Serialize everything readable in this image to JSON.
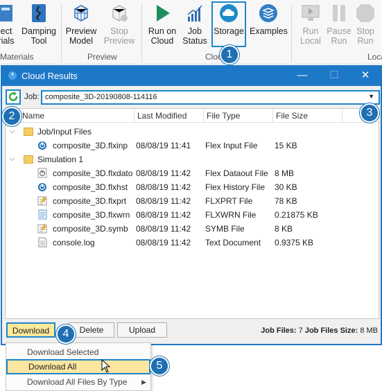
{
  "ribbon": {
    "buttons": [
      {
        "label1": "ect",
        "label2": "rials",
        "icon": "material-icon"
      },
      {
        "label1": "Damping",
        "label2": "Tool",
        "icon": "damping-icon"
      },
      {
        "label1": "Preview",
        "label2": "Model",
        "icon": "preview-cube-icon"
      },
      {
        "label1": "Stop",
        "label2": "Preview",
        "icon": "stop-preview-icon"
      },
      {
        "label1": "Run on",
        "label2": "Cloud",
        "icon": "play-icon"
      },
      {
        "label1": "Job",
        "label2": "Status",
        "icon": "bar-chart-icon"
      },
      {
        "label1": "Storage",
        "label2": "",
        "icon": "cloud-icon"
      },
      {
        "label1": "Examples",
        "label2": "",
        "icon": "examples-icon"
      },
      {
        "label1": "Run",
        "label2": "Local",
        "icon": "run-local-icon"
      },
      {
        "label1": "Pause",
        "label2": "Run",
        "icon": "pause-icon"
      },
      {
        "label1": "Stop",
        "label2": "Run",
        "icon": "stop-icon"
      }
    ],
    "groups": {
      "materials": "Materials",
      "preview": "Preview",
      "cloud": "Clou",
      "local": "Loca"
    }
  },
  "window": {
    "title": "Cloud Results",
    "controls": {
      "minimize": "—",
      "maximize": "☐",
      "close": "✕"
    }
  },
  "job": {
    "label": "Job:",
    "value": "composite_3D-20190808-114116"
  },
  "columns": [
    "Name",
    "Last Modified",
    "File Type",
    "File Size"
  ],
  "tree": [
    {
      "kind": "folder",
      "name": "Job/Input Files"
    },
    {
      "kind": "file",
      "name": "composite_3D.flxinp",
      "modified": "08/08/19 11:41",
      "type": "Flex Input File",
      "size": "15 KB",
      "icon": "power-icon"
    },
    {
      "kind": "folder",
      "name": "Simulation 1"
    },
    {
      "kind": "file",
      "name": "composite_3D.flxdato",
      "modified": "08/08/19 11:42",
      "type": "Flex Dataout File",
      "size": "8 MB",
      "icon": "power-gray-icon"
    },
    {
      "kind": "file",
      "name": "composite_3D.flxhst",
      "modified": "08/08/19 11:42",
      "type": "Flex History File",
      "size": "30 KB",
      "icon": "power-icon"
    },
    {
      "kind": "file",
      "name": "composite_3D.flxprt",
      "modified": "08/08/19 11:42",
      "type": "FLXPRT File",
      "size": "78 KB",
      "icon": "notepad-icon"
    },
    {
      "kind": "file",
      "name": "composite_3D.flxwrn",
      "modified": "08/08/19 11:42",
      "type": "FLXWRN File",
      "size": "0.21875 KB",
      "icon": "document-icon"
    },
    {
      "kind": "file",
      "name": "composite_3D.symb",
      "modified": "08/08/19 11:42",
      "type": "SYMB File",
      "size": "8 KB",
      "icon": "notepad-icon"
    },
    {
      "kind": "file",
      "name": "console.log",
      "modified": "08/08/19 11:42",
      "type": "Text Document",
      "size": "0.9375 KB",
      "icon": "text-file-icon"
    }
  ],
  "buttons": {
    "download": "Download",
    "delete": "Delete",
    "upload": "Upload"
  },
  "status": {
    "files_label": "Job Files:",
    "files_value": "7",
    "size_label": "Job Files Size:",
    "size_value": "8 MB"
  },
  "menu": {
    "selected": "Download Selected",
    "all": "Download All",
    "by_type": "Download All Files By Type"
  },
  "callouts": [
    "1",
    "2",
    "3",
    "4",
    "5"
  ],
  "colors": {
    "accent": "#1c87c9",
    "titlebar": "#1e78c8",
    "highlight": "#fbe6a0",
    "callout": "#1f6fb3"
  }
}
